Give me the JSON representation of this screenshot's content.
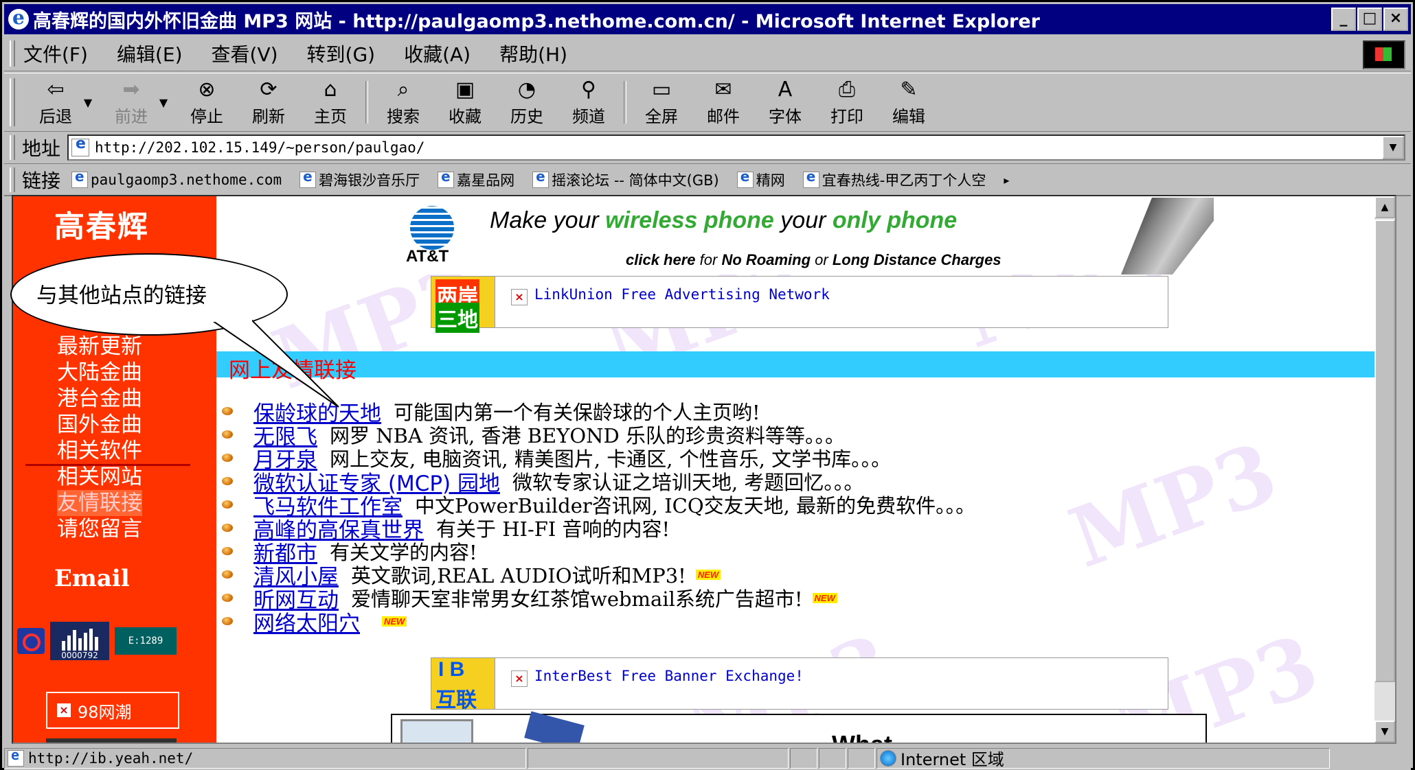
{
  "window": {
    "title": "高春辉的国内外怀旧金曲 MP3 网站 - http://paulgaomp3.nethome.com.cn/ - Microsoft Internet Explorer",
    "buttons": [
      "_",
      "□",
      "×"
    ]
  },
  "menubar": {
    "items": [
      "文件(F)",
      "编辑(E)",
      "查看(V)",
      "转到(G)",
      "收藏(A)",
      "帮助(H)"
    ]
  },
  "toolbar": {
    "back": "后退",
    "forward": "前进",
    "stop": "停止",
    "refresh": "刷新",
    "home": "主页",
    "search": "搜索",
    "favorites": "收藏",
    "history": "历史",
    "channels": "频道",
    "fullscreen": "全屏",
    "mail": "邮件",
    "font": "字体",
    "print": "打印",
    "edit": "编辑"
  },
  "address": {
    "label": "地址",
    "url": "http://202.102.15.149/~person/paulgao/"
  },
  "links": {
    "label": "链接",
    "items": [
      "paulgaomp3.nethome.com",
      "碧海银沙音乐厅",
      "嘉星品网",
      "摇滚论坛 -- 简体中文(GB)",
      "精网",
      "宜春热线-甲乙丙丁个人空"
    ]
  },
  "sidebar": {
    "title": "高春辉",
    "nav": [
      "最新更新",
      "大陆金曲",
      "港台金曲",
      "国外金曲",
      "相关软件",
      "相关网站",
      "友情联接",
      "请您留言"
    ],
    "email": "Email",
    "counter_text": "0000792",
    "counter_text2": "E:1289",
    "banner_text": "98网潮"
  },
  "ads": {
    "att_name": "AT&T",
    "att_headline_1": "Make your",
    "att_headline_2": "wireless phone",
    "att_headline_3": "your",
    "att_headline_4": "only phone",
    "att_sub_1": "click here",
    "att_sub_2": "for",
    "att_sub_3": "No Roaming",
    "att_sub_4": "or",
    "att_sub_5": "Long Distance Charges",
    "linkunion_logo_1": "两岸",
    "linkunion_logo_2": "三地",
    "linkunion_text": "LinkUnion Free Advertising Network",
    "interbest_logo_1": "I B",
    "interbest_logo_2": "互联",
    "interbest_text": "InterBest Free Banner Exchange!",
    "bottom_text": "What"
  },
  "section": {
    "title": "网上友情联接"
  },
  "friend_links": [
    {
      "name": "保龄球的天地",
      "desc": "可能国内第一个有关保龄球的个人主页哟!",
      "new": false
    },
    {
      "name": "无限飞",
      "desc": "网罗 NBA 资讯, 香港 BEYOND 乐队的珍贵资料等等。。。",
      "new": false
    },
    {
      "name": "月牙泉",
      "desc": "网上交友, 电脑资讯, 精美图片, 卡通区, 个性音乐, 文学书库。。。",
      "new": false
    },
    {
      "name": "微软认证专家 (MCP) 园地",
      "desc": "微软专家认证之培训天地, 考题回忆。。。",
      "new": false
    },
    {
      "name": "飞马软件工作室",
      "desc": "中文PowerBuilder咨讯网, ICQ交友天地, 最新的免费软件。。。",
      "new": false
    },
    {
      "name": "高峰的高保真世界",
      "desc": "有关于 HI-FI 音响的内容!",
      "new": false
    },
    {
      "name": "新都市",
      "desc": "有关文学的内容!",
      "new": false
    },
    {
      "name": "清风小屋",
      "desc": "英文歌词,REAL AUDIO试听和MP3!",
      "new": true
    },
    {
      "name": "昕网互动",
      "desc": "爱情聊天室非常男女红茶馆webmail系统广告超市!",
      "new": true
    },
    {
      "name": "网络太阳穴",
      "desc": "",
      "new": true
    }
  ],
  "new_badge": "NEW",
  "callout": {
    "text": "与其他站点的链接"
  },
  "watermark": "MP3",
  "statusbar": {
    "url": "http://ib.yeah.net/",
    "zone": "Internet 区域"
  }
}
